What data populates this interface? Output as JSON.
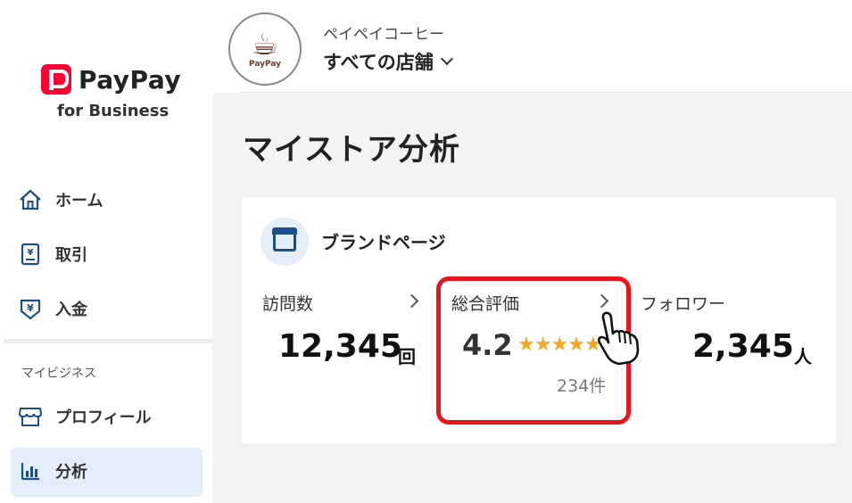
{
  "sidebar": {
    "logo_text": "PayPay",
    "logo_sub": "for Business",
    "items": [
      {
        "label": "ホーム",
        "icon": "home-icon"
      },
      {
        "label": "取引",
        "icon": "receipt-icon"
      },
      {
        "label": "入金",
        "icon": "yen-shield-icon"
      }
    ],
    "section_label": "マイビジネス",
    "business_items": [
      {
        "label": "プロフィール",
        "icon": "storefront-icon"
      },
      {
        "label": "分析",
        "icon": "bar-chart-icon",
        "active": true
      }
    ]
  },
  "header": {
    "store_name": "ペイペイコーヒー",
    "store_select": "すべての店舗",
    "avatar_text": "PayPay"
  },
  "main": {
    "title": "マイストア分析",
    "card": {
      "title": "ブランドページ",
      "visits": {
        "label": "訪問数",
        "value": "12,345",
        "unit": "回"
      },
      "rating": {
        "label": "総合評価",
        "value": "4.2",
        "stars": "★★★★★",
        "count": "234件"
      },
      "followers": {
        "label": "フォロワー",
        "value": "2,345",
        "unit": "人"
      }
    }
  },
  "colors": {
    "brand_red": "#ff0033",
    "highlight_red": "#e8141c",
    "accent_blue": "#1a4f8b",
    "active_bg": "#e4eef8",
    "star": "#f5a623"
  }
}
